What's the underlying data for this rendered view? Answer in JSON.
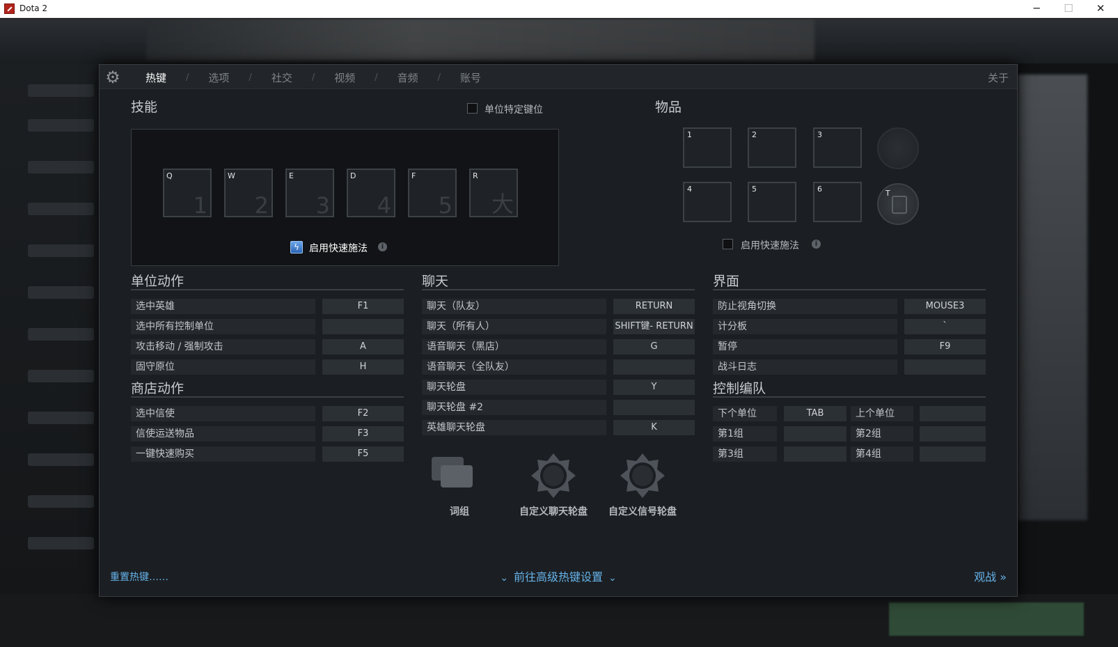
{
  "window": {
    "title": "Dota 2",
    "minimize": "─",
    "maximize": "☐",
    "close": "✕"
  },
  "nav": {
    "tabs": [
      "热键",
      "选项",
      "社交",
      "视频",
      "音频",
      "账号"
    ],
    "separator": "/",
    "about": "关于"
  },
  "skills": {
    "title": "技能",
    "unit_specific_label": "单位特定键位",
    "keys": [
      {
        "key": "Q",
        "num": "1"
      },
      {
        "key": "W",
        "num": "2"
      },
      {
        "key": "E",
        "num": "3"
      },
      {
        "key": "D",
        "num": "4"
      },
      {
        "key": "F",
        "num": "5"
      },
      {
        "key": "R",
        "num": "大"
      }
    ],
    "quickcast_label": "启用快速施法"
  },
  "items": {
    "title": "物品",
    "slots": [
      "1",
      "2",
      "3",
      "4",
      "5",
      "6"
    ],
    "tp_key": "T",
    "quickcast_label": "启用快速施法"
  },
  "unit_actions": {
    "title": "单位动作",
    "rows": [
      {
        "name": "选中英雄",
        "key": "F1"
      },
      {
        "name": "选中所有控制单位",
        "key": ""
      },
      {
        "name": "攻击移动 / 强制攻击",
        "key": "A"
      },
      {
        "name": "固守原位",
        "key": "H"
      }
    ]
  },
  "shop_actions": {
    "title": "商店动作",
    "rows": [
      {
        "name": "选中信使",
        "key": "F2"
      },
      {
        "name": "信使运送物品",
        "key": "F3"
      },
      {
        "name": "一键快速购买",
        "key": "F5"
      }
    ]
  },
  "chat": {
    "title": "聊天",
    "rows": [
      {
        "name": "聊天（队友）",
        "key": "RETURN"
      },
      {
        "name": "聊天（所有人）",
        "key": "SHIFT键- RETURN"
      },
      {
        "name": "语音聊天（黑店）",
        "key": "G"
      },
      {
        "name": "语音聊天（全队友）",
        "key": ""
      },
      {
        "name": "聊天轮盘",
        "key": "Y"
      },
      {
        "name": "聊天轮盘 #2",
        "key": ""
      },
      {
        "name": "英雄聊天轮盘",
        "key": "K"
      }
    ],
    "icons": [
      "词组",
      "自定义聊天轮盘",
      "自定义信号轮盘"
    ]
  },
  "interface": {
    "title": "界面",
    "rows": [
      {
        "name": "防止视角切换",
        "key": "MOUSE3"
      },
      {
        "name": "计分板",
        "key": "`"
      },
      {
        "name": "暂停",
        "key": "F9"
      },
      {
        "name": "战斗日志",
        "key": ""
      }
    ]
  },
  "control_groups": {
    "title": "控制编队",
    "rows": [
      [
        {
          "name": "下个单位",
          "key": "TAB"
        },
        {
          "name": "上个单位",
          "key": ""
        }
      ],
      [
        {
          "name": "第1组",
          "key": ""
        },
        {
          "name": "第2组",
          "key": ""
        }
      ],
      [
        {
          "name": "第3组",
          "key": ""
        },
        {
          "name": "第4组",
          "key": ""
        }
      ]
    ]
  },
  "footer": {
    "reset": "重置热键……",
    "advanced": "前往高级热键设置",
    "spectate": "观战 »"
  },
  "colors": {
    "accent": "#66b3ea",
    "panel": "#1b1e22"
  }
}
